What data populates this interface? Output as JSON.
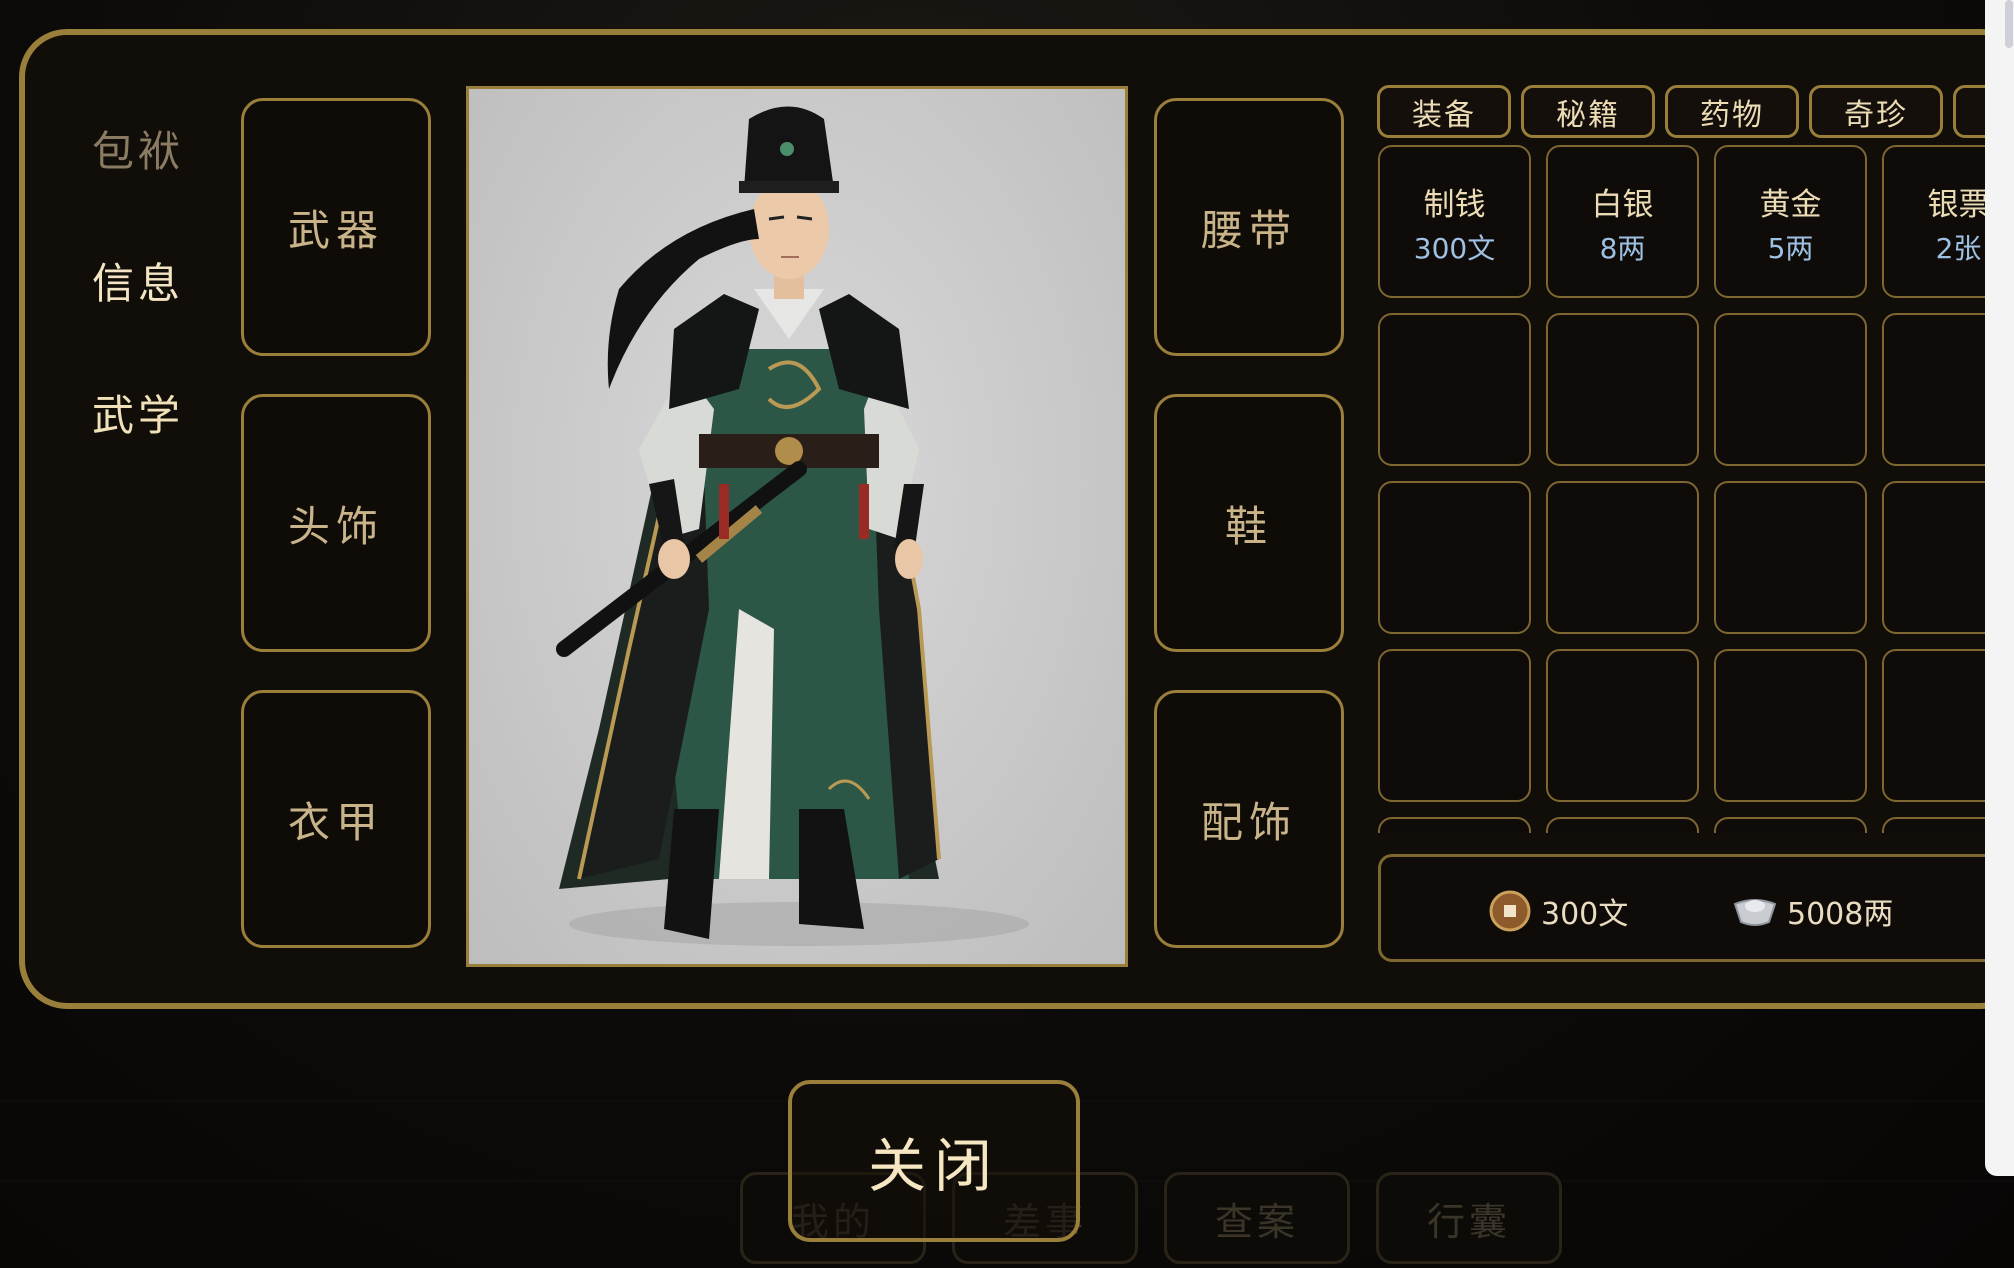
{
  "side_nav": {
    "items": [
      {
        "label": "包袱"
      },
      {
        "label": "信息"
      },
      {
        "label": "武学"
      }
    ]
  },
  "left_slots": {
    "weapon": "武器",
    "headwear": "头饰",
    "armor": "衣甲"
  },
  "right_slots": {
    "belt": "腰带",
    "shoes": "鞋",
    "accessory": "配饰"
  },
  "tabs": [
    "装备",
    "秘籍",
    "药物",
    "奇珍",
    ""
  ],
  "items": [
    {
      "name": "制钱",
      "value": "300文"
    },
    {
      "name": "白银",
      "value": "8两"
    },
    {
      "name": "黄金",
      "value": "5两"
    },
    {
      "name": "银票",
      "value": "2张"
    }
  ],
  "currency": {
    "coins": "300文",
    "silver": "5008两",
    "coin_icon": "copper-coin-icon",
    "silver_icon": "silver-ingot-icon"
  },
  "close_label": "关闭",
  "bottom_nav": [
    "我的",
    "差事",
    "查案",
    "行囊"
  ],
  "colors": {
    "gold_border": "#9a7f3a",
    "panel_bg": "#110d09",
    "value_text": "#9ec0e2"
  }
}
